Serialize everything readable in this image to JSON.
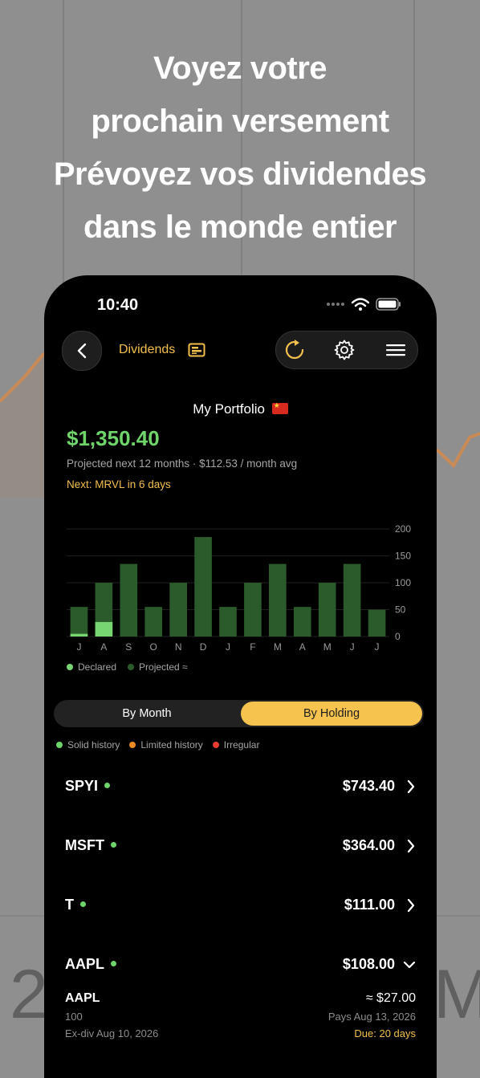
{
  "headline": {
    "lines": [
      "Voyez votre",
      "prochain versement",
      "Prévoyez vos dividendes",
      "dans le monde entier"
    ]
  },
  "background": {
    "digits": [
      "2",
      "M"
    ]
  },
  "status_bar": {
    "time": "10:40"
  },
  "nav": {
    "title": "Dividends",
    "icons": [
      "chevron-left-icon",
      "report-icon",
      "refresh-icon",
      "gear-icon",
      "menu-icon"
    ]
  },
  "portfolio": {
    "title": "My Portfolio",
    "flag_icon": "china-flag-icon",
    "total": "$1,350.40",
    "subtext": "Projected next 12 months · $112.53 / month avg",
    "next": "Next: MRVL in 6 days"
  },
  "chart_data": {
    "type": "bar",
    "categories": [
      "J",
      "A",
      "S",
      "O",
      "N",
      "D",
      "J",
      "F",
      "M",
      "A",
      "M",
      "J",
      "J"
    ],
    "series": [
      {
        "name": "Declared",
        "values": [
          5,
          27,
          0,
          0,
          0,
          0,
          0,
          0,
          0,
          0,
          0,
          0,
          0
        ]
      },
      {
        "name": "Projected ≈",
        "values": [
          55,
          100,
          135,
          55,
          100,
          185,
          55,
          100,
          135,
          55,
          100,
          135,
          50
        ]
      }
    ],
    "y_ticks": [
      "200",
      "150",
      "100",
      "50",
      "0"
    ],
    "ylim": [
      0,
      200
    ],
    "grid": true,
    "legend_placement": "bottom-left",
    "colors": {
      "declared": "#78d672",
      "projected": "#2b5a2b"
    }
  },
  "legend": {
    "declared": "Declared",
    "projected": "Projected ≈"
  },
  "tabs": {
    "by_month": "By Month",
    "by_holding": "By Holding",
    "selected": "By Holding"
  },
  "history_legend": {
    "solid": "Solid history",
    "limited": "Limited history",
    "irregular": "Irregular",
    "colors": {
      "solid": "#6fd56a",
      "limited": "#f08a24",
      "irregular": "#ec3b30"
    }
  },
  "holdings": [
    {
      "ticker": "SPYI",
      "amount": "$743.40",
      "expanded": false
    },
    {
      "ticker": "MSFT",
      "amount": "$364.00",
      "expanded": false
    },
    {
      "ticker": "T",
      "amount": "$111.00",
      "expanded": false
    },
    {
      "ticker": "AAPL",
      "amount": "$108.00",
      "expanded": true
    }
  ],
  "detail": {
    "ticker": "AAPL",
    "amount": "≈ $27.00",
    "shares": "100",
    "pays": "Pays Aug 13, 2026",
    "exdiv": "Ex-div Aug 10, 2026",
    "due": "Due: 20 days"
  }
}
